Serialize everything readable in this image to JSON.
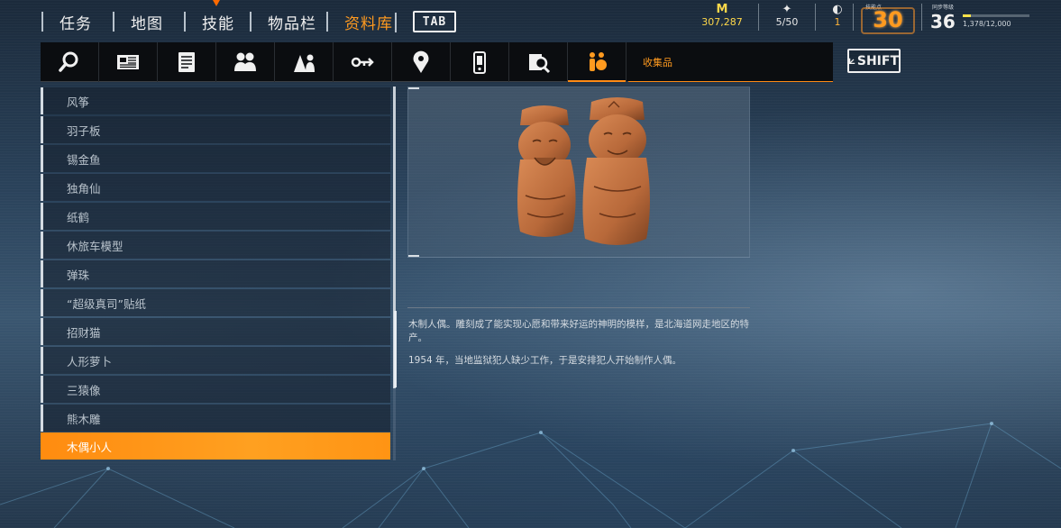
{
  "nav": {
    "tabs": [
      {
        "label": "任务"
      },
      {
        "label": "地图"
      },
      {
        "label": "技能"
      },
      {
        "label": "物品栏"
      },
      {
        "label": "资料库"
      }
    ],
    "active_tab": "资料库",
    "tab_key": "TAB"
  },
  "hud": {
    "money": "307,287",
    "money_icon": "M",
    "collectibles": "5/50",
    "tokens": "1",
    "skill_points_label": "技能点",
    "skill_points": "30",
    "sync_level_label": "同步等级",
    "sync_level": "36",
    "xp_text": "1,378/12,000",
    "xp_fraction": 0.115
  },
  "iconbar": {
    "icons": [
      "search-icon",
      "news-icon",
      "document-icon",
      "people-icon",
      "person-group-icon",
      "key-icon",
      "location-pin-icon",
      "phone-icon",
      "profile-search-icon",
      "collectibles-icon"
    ],
    "selected_label": "收集品",
    "shift_key": "SHIFT"
  },
  "list": {
    "items": [
      "风筝",
      "羽子板",
      "锡金鱼",
      "独角仙",
      "纸鹤",
      "休旅车模型",
      "弹珠",
      "“超级真司”贴纸",
      "招财猫",
      "人形萝卜",
      "三猿像",
      "熊木雕",
      "木偶小人"
    ],
    "selected_index": 12
  },
  "detail": {
    "description": [
      "木制人偶。雕刻成了能实现心愿和带来好运的神明的模样，是北海道网走地区的特产。",
      "1954 年，当地监狱犯人缺少工作，于是安排犯人开始制作人偶。"
    ]
  },
  "colors": {
    "accent": "#ff9a1f",
    "selected_row": "#ff8c10",
    "money": "#ffd84a",
    "bar_bg": "#0b0d10"
  }
}
